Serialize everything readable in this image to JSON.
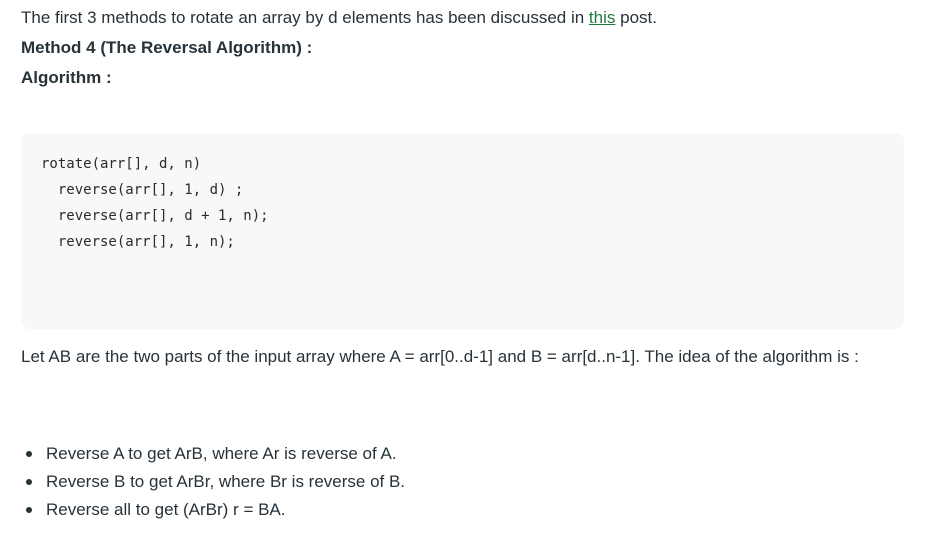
{
  "intro": {
    "before_link": "The first 3 methods to rotate an array by d elements has been discussed in ",
    "link_text": "this",
    "after_link": " post."
  },
  "heading_method": "Method 4 (The Reversal Algorithm) :",
  "heading_algorithm": "Algorithm :",
  "code": {
    "lines": [
      "rotate(arr[], d, n)",
      "  reverse(arr[], 1, d) ;",
      "  reverse(arr[], d + 1, n);",
      "  reverse(arr[], 1, n);"
    ]
  },
  "paragraph": "Let AB are the two parts of the input array where A = arr[0..d-1] and B = arr[d..n-1]. The idea of the algorithm is :",
  "bullets": [
    "Reverse A to get ArB, where Ar is reverse of A.",
    "Reverse B to get ArBr, where Br is reverse of B.",
    "Reverse all to get (ArBr) r = BA."
  ],
  "colors": {
    "text": "#273239",
    "link": "#1f7a3a",
    "code_background": "#f8f8f8"
  }
}
